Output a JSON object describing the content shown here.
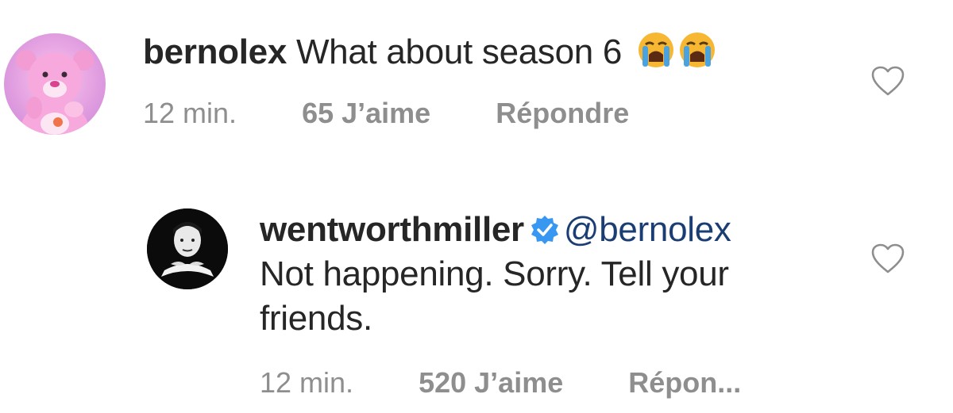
{
  "comments": [
    {
      "avatar_icon": "pink-bear-avatar",
      "username": "bernolex",
      "text": "What about season 6",
      "emoji": "loudly-crying-face",
      "time": "12 min.",
      "likes": "65 J’aime",
      "reply": "Répondre"
    },
    {
      "avatar_icon": "portrait-avatar",
      "username": "wentworthmiller",
      "verified": true,
      "mention": "@bernolex",
      "text": "Not happening. Sorry. Tell your friends.",
      "time": "12 min.",
      "likes": "520 J’aime",
      "reply": "Répon..."
    }
  ],
  "colors": {
    "text": "#262626",
    "meta": "#8e8e8e",
    "mention": "#1a3d73",
    "verified": "#3897f0",
    "emoji_face": "#f7b733",
    "emoji_tears": "#4aa3df"
  }
}
